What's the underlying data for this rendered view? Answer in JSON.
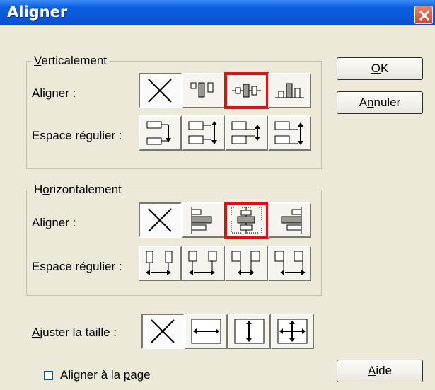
{
  "window": {
    "title": "Aligner"
  },
  "buttons": {
    "ok": "OK",
    "cancel": "Annuler",
    "help": "Aide"
  },
  "vertical": {
    "title": "Verticalement",
    "align_label": "Aligner :",
    "spacing_label": "Espace régulier :",
    "selected_align": "center"
  },
  "horizontal": {
    "title": "Horizontalement",
    "align_label": "Aligner :",
    "spacing_label": "Espace régulier :",
    "selected_align": "center"
  },
  "resize": {
    "label": "Ajuster la taille :"
  },
  "page_align": {
    "label": "Aligner à la page",
    "checked": false
  },
  "colors": {
    "selection": "#e01010",
    "titlebar": "#0b56d8"
  }
}
